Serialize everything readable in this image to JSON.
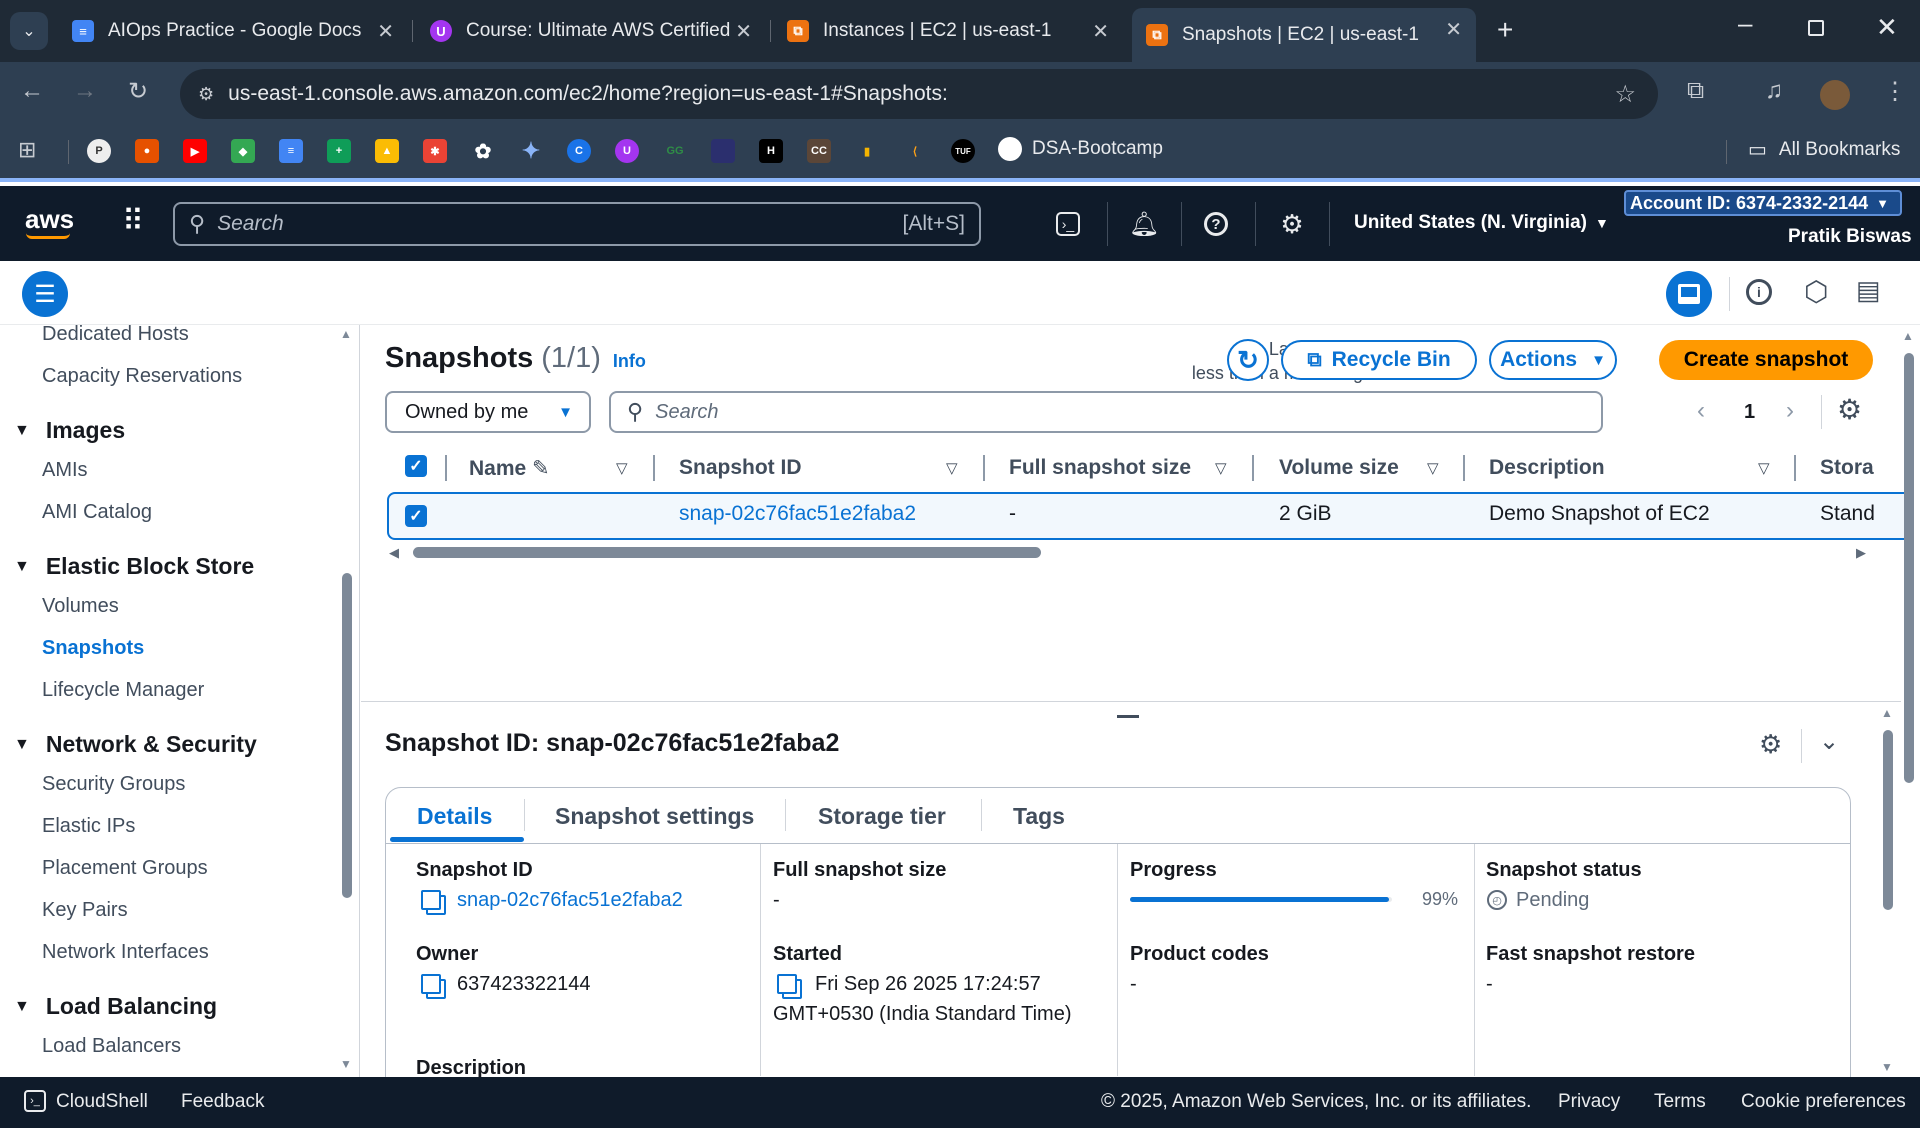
{
  "browser": {
    "tabs": [
      {
        "title": "AIOps Practice - Google Docs",
        "icon": "google-docs-icon",
        "color": "#4285f4",
        "glyph": "≡"
      },
      {
        "title": "Course: Ultimate AWS Certified",
        "icon": "udemy-icon",
        "color": "#a435f0",
        "glyph": "U"
      },
      {
        "title": "Instances | EC2 | us-east-1",
        "icon": "aws-ec2-icon",
        "color": "#ec7211",
        "glyph": "⧉"
      },
      {
        "title": "Snapshots | EC2 | us-east-1",
        "icon": "aws-ec2-icon",
        "color": "#ec7211",
        "glyph": "⧉"
      }
    ],
    "url": "us-east-1.console.aws.amazon.com/ec2/home?region=us-east-1#Snapshots:",
    "bookmarks": {
      "named_label": "DSA-Bootcamp",
      "all_bookmarks_label": "All Bookmarks"
    }
  },
  "aws_header": {
    "logo": "aws",
    "search_placeholder": "Search",
    "search_shortcut": "[Alt+S]",
    "region": "United States (N. Virginia)",
    "account_id": "Account ID: 6374-2332-2144",
    "user": "Pratik Biswas"
  },
  "sidebar": {
    "items": [
      {
        "type": "item",
        "label": "Dedicated Hosts"
      },
      {
        "type": "item",
        "label": "Capacity Reservations"
      },
      {
        "type": "head",
        "label": "Images"
      },
      {
        "type": "item",
        "label": "AMIs"
      },
      {
        "type": "item",
        "label": "AMI Catalog"
      },
      {
        "type": "head",
        "label": "Elastic Block Store"
      },
      {
        "type": "item",
        "label": "Volumes"
      },
      {
        "type": "item",
        "label": "Snapshots",
        "active": true
      },
      {
        "type": "item",
        "label": "Lifecycle Manager"
      },
      {
        "type": "head",
        "label": "Network & Security"
      },
      {
        "type": "item",
        "label": "Security Groups"
      },
      {
        "type": "item",
        "label": "Elastic IPs"
      },
      {
        "type": "item",
        "label": "Placement Groups"
      },
      {
        "type": "item",
        "label": "Key Pairs"
      },
      {
        "type": "item",
        "label": "Network Interfaces"
      },
      {
        "type": "head",
        "label": "Load Balancing"
      },
      {
        "type": "item",
        "label": "Load Balancers"
      }
    ]
  },
  "main": {
    "title": "Snapshots",
    "count": "(1/1)",
    "info": "Info",
    "last_updated_label": "Last updated",
    "last_updated_value": "less than a minute ago",
    "recycle_bin": "Recycle Bin",
    "actions": "Actions",
    "create": "Create snapshot",
    "filter": "Owned by me",
    "search_placeholder": "Search",
    "page": "1",
    "columns": [
      "Name",
      "Snapshot ID",
      "Full snapshot size",
      "Volume size",
      "Description",
      "Stora"
    ],
    "rows": [
      {
        "name": "",
        "snapshot_id": "snap-02c76fac51e2faba2",
        "full_size": "-",
        "volume_size": "2 GiB",
        "description": "Demo Snapshot of EC2",
        "storage": "Stand"
      }
    ]
  },
  "detail": {
    "title": "Snapshot ID: snap-02c76fac51e2faba2",
    "tabs": [
      "Details",
      "Snapshot settings",
      "Storage tier",
      "Tags"
    ],
    "fields": {
      "snapshot_id_label": "Snapshot ID",
      "snapshot_id": "snap-02c76fac51e2faba2",
      "owner_label": "Owner",
      "owner": "637423322144",
      "description_label": "Description",
      "full_size_label": "Full snapshot size",
      "full_size": "-",
      "started_label": "Started",
      "started_line1": "Fri Sep 26 2025 17:24:57",
      "started_line2": "GMT+0530 (India Standard Time)",
      "progress_label": "Progress",
      "progress_text": "99%",
      "progress_value": 0.99,
      "product_codes_label": "Product codes",
      "product_codes": "-",
      "status_label": "Snapshot status",
      "status": "Pending",
      "fsr_label": "Fast snapshot restore",
      "fsr": "-"
    }
  },
  "footer": {
    "cloudshell": "CloudShell",
    "feedback": "Feedback",
    "copyright": "© 2025, Amazon Web Services, Inc. or its affiliates.",
    "privacy": "Privacy",
    "terms": "Terms",
    "cookies": "Cookie preferences"
  },
  "colors": {
    "accent": "#0972d3",
    "primary_button": "#ff9900",
    "header": "#0f1b2a"
  }
}
